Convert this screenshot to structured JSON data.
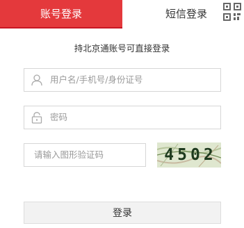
{
  "tabs": {
    "account_login": "账号登录",
    "sms_login": "短信登录"
  },
  "subtitle": "持北京通账号可直接登录",
  "username": {
    "placeholder": "用户名/手机号/身份证号",
    "icon": "user-icon"
  },
  "password": {
    "placeholder": "密码",
    "icon": "lock-icon"
  },
  "captcha": {
    "placeholder": "请输入图形验证码",
    "code": "4502"
  },
  "login_button": "登录",
  "qr_toggle_icon": "qr-code-icon",
  "colors": {
    "accent": "#e4393c",
    "border": "#d6d6d6",
    "placeholder": "#9a9a9a",
    "button_bg": "#f2f2f2"
  }
}
